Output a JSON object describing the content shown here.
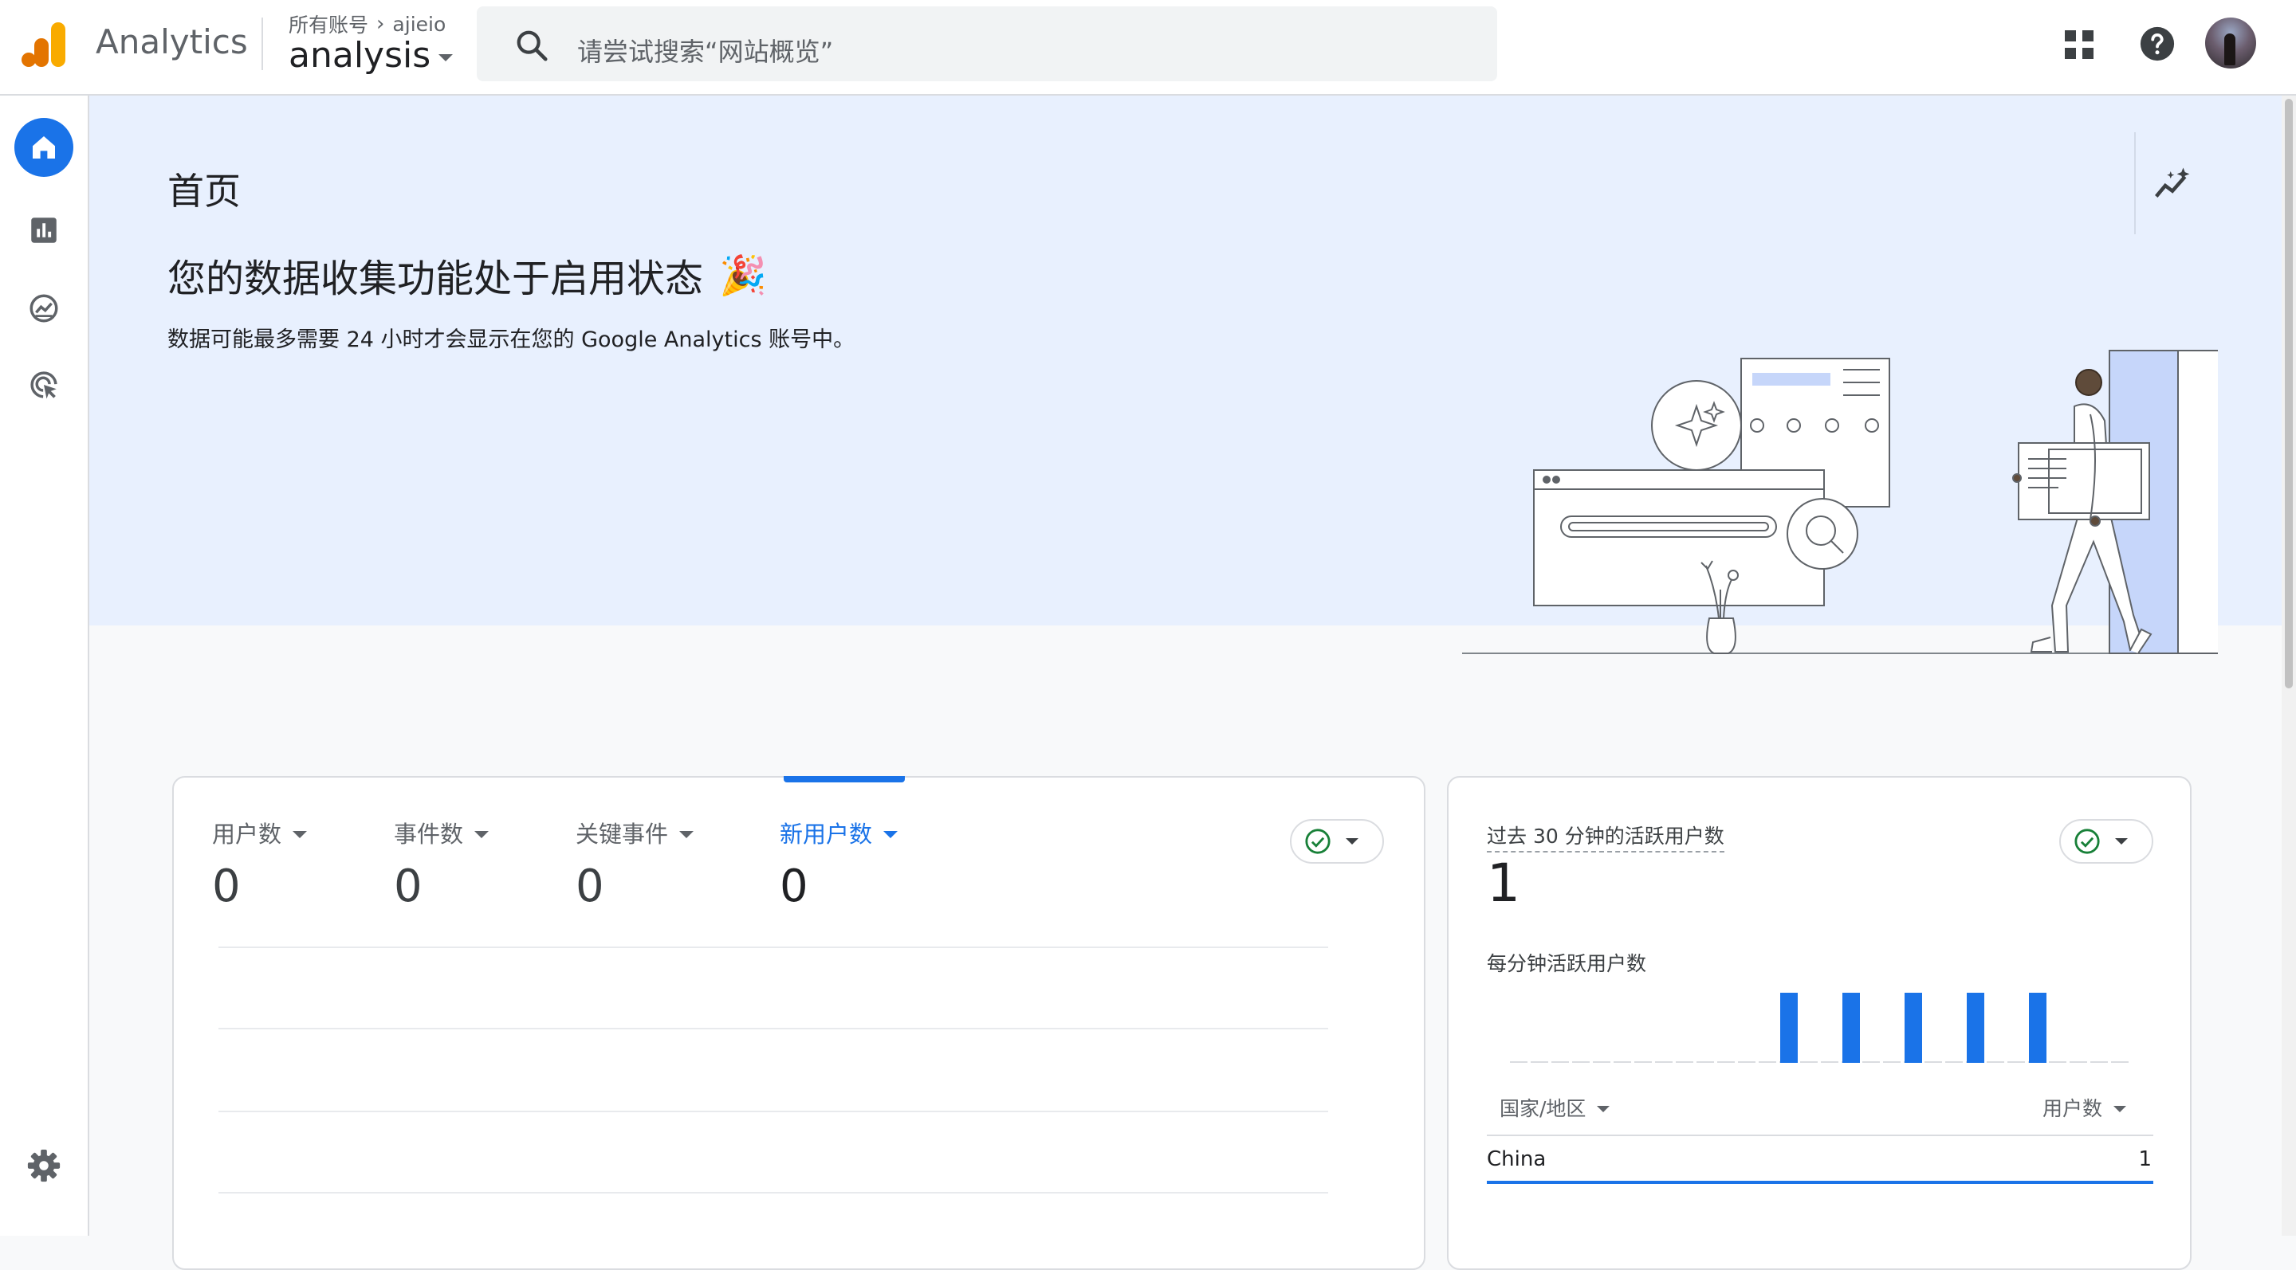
{
  "header": {
    "app_title": "Analytics",
    "breadcrumb_root": "所有账号",
    "breadcrumb_account": "ajieio",
    "property_name": "analysis",
    "search_placeholder": "请尝试搜索“网站概览”",
    "icons": [
      "analytics-logo-icon",
      "search-icon",
      "apps-grid-icon",
      "help-icon",
      "avatar"
    ]
  },
  "sidenav": {
    "items": [
      {
        "name": "home",
        "icon": "home-icon",
        "active": true
      },
      {
        "name": "reports",
        "icon": "bar-chart-icon",
        "active": false
      },
      {
        "name": "explore",
        "icon": "explore-icon",
        "active": false
      },
      {
        "name": "advertising",
        "icon": "target-cursor-icon",
        "active": false
      }
    ],
    "settings_icon": "gear-icon"
  },
  "hero": {
    "page_title": "首页",
    "heading": "您的数据收集功能处于启用状态",
    "heading_emoji": "🎉",
    "description": "数据可能最多需要 24 小时才会显示在您的 Google Analytics 账号中。",
    "insights_icon": "insights-sparkline-icon"
  },
  "metrics_card": {
    "metrics": [
      {
        "label": "用户数",
        "value": "0",
        "active": false
      },
      {
        "label": "事件数",
        "value": "0",
        "active": false
      },
      {
        "label": "关键事件",
        "value": "0",
        "active": false
      },
      {
        "label": "新用户数",
        "value": "0",
        "active": true
      }
    ],
    "status_icon": "check-circle-icon"
  },
  "realtime_card": {
    "title": "过去 30 分钟的活跃用户数",
    "value": "1",
    "subtitle": "每分钟活跃用户数",
    "col_country": "国家/地区",
    "col_users": "用户数",
    "rows": [
      {
        "country": "China",
        "users": "1"
      }
    ],
    "status_icon": "check-circle-icon"
  },
  "chart_data": {
    "type": "bar",
    "title": "每分钟活跃用户数",
    "categories": [
      "-30",
      "-29",
      "-28",
      "-27",
      "-26",
      "-25",
      "-24",
      "-23",
      "-22",
      "-21",
      "-20",
      "-19",
      "-18",
      "-17",
      "-16",
      "-15",
      "-14",
      "-13",
      "-12",
      "-11",
      "-10",
      "-9",
      "-8",
      "-7",
      "-6",
      "-5",
      "-4",
      "-3",
      "-2",
      "-1"
    ],
    "values": [
      0,
      0,
      0,
      0,
      0,
      0,
      0,
      0,
      0,
      0,
      0,
      0,
      0,
      1,
      0,
      0,
      1,
      0,
      0,
      1,
      0,
      0,
      1,
      0,
      0,
      1,
      0,
      0,
      0,
      0
    ],
    "xlabel": "",
    "ylabel": "",
    "grid": false,
    "colors": {
      "bar": "#1a73e8",
      "baseline": "#dadce0"
    }
  },
  "colors": {
    "accent": "#1a73e8",
    "hero_bg": "#e8f0fe",
    "success": "#188038"
  }
}
